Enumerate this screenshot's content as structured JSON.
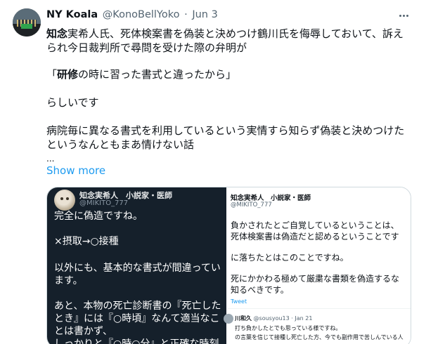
{
  "tweet": {
    "author_name": "NY Koala",
    "author_handle": "@KonoBellYoko",
    "separator": "·",
    "date": "Jun 3",
    "body": {
      "line1_bold": "知念",
      "line1_rest": "実希人氏、死体検案書を偽装と決めつけ鶴川氏を侮辱しておいて、訴え",
      "line2": "られ今日裁判所で尋問を受けた際の弁明が",
      "line3_open": "「",
      "line3_bold": "研修",
      "line3_rest": "の時に習った書式と違ったから」",
      "line4": "らしいです",
      "line5": "病院毎に異なる書式を利用しているという実情すら知らず偽装と決めつけた",
      "line6": "というなんともまあ情けない話",
      "ellipsis": "..."
    },
    "show_more": "Show more"
  },
  "media": {
    "left": {
      "name": "知念実希人　小説家・医師",
      "handle": "@MIKITO_777",
      "lines": [
        "完全に偽造ですね。",
        "×摂取→○接種",
        "以外にも、基本的な書式が間違ってい",
        "ます。",
        "あと、本物の死亡診断書の『死亡した",
        "とき』には『○時頃』なんて適当なこ",
        "とは書かず、",
        "しっかりと『○時○分』と正確な時刻"
      ]
    },
    "right": {
      "name": "知念実希人　小説家・医師",
      "handle": "@MIKITO_777",
      "lines": [
        "負かされたとご自覚しているということは、",
        "死体検案書は偽造だと認めるということです",
        "に落ちたとはこのことですね。",
        "死にかかわる極めて厳粛な書類を偽造するな",
        "知るべきです。"
      ],
      "tweet_label": "Tweet",
      "reply": {
        "name": "川和久",
        "handle": "@sousyou13 · Jan 21",
        "lines": [
          "打ち負かしたとでも思っている様ですね。",
          "の言葉を信じて接種し死亡した方、今でも副作用で苦しんでいる人"
        ]
      }
    }
  }
}
